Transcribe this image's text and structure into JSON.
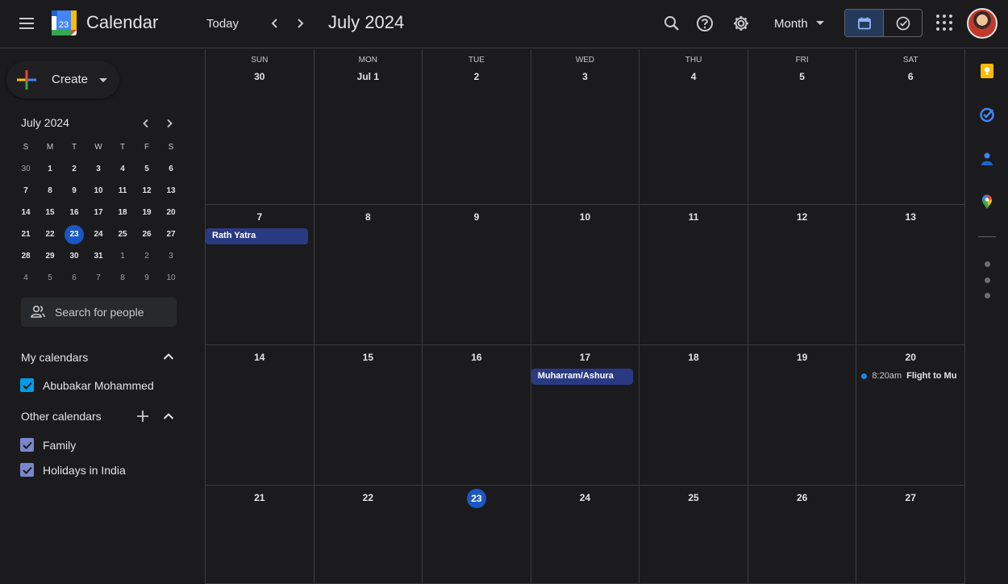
{
  "header": {
    "app_title": "Calendar",
    "logo_day": "23",
    "today_label": "Today",
    "current_range": "July 2024",
    "view_label": "Month"
  },
  "sidebar": {
    "create_label": "Create",
    "mini_calendar": {
      "title": "July 2024",
      "weekdays": [
        "S",
        "M",
        "T",
        "W",
        "T",
        "F",
        "S"
      ],
      "weeks": [
        [
          "30",
          "1",
          "2",
          "3",
          "4",
          "5",
          "6"
        ],
        [
          "7",
          "8",
          "9",
          "10",
          "11",
          "12",
          "13"
        ],
        [
          "14",
          "15",
          "16",
          "17",
          "18",
          "19",
          "20"
        ],
        [
          "21",
          "22",
          "23",
          "24",
          "25",
          "26",
          "27"
        ],
        [
          "28",
          "29",
          "30",
          "31",
          "1",
          "2",
          "3"
        ],
        [
          "4",
          "5",
          "6",
          "7",
          "8",
          "9",
          "10"
        ]
      ]
    },
    "search_people_placeholder": "Search for people",
    "my_calendars": {
      "title": "My calendars",
      "items": [
        {
          "label": "Abubakar Mohammed",
          "color": "#039be5",
          "checked": true
        }
      ]
    },
    "other_calendars": {
      "title": "Other calendars",
      "items": [
        {
          "label": "Family",
          "color": "#7986cb",
          "checked": true
        },
        {
          "label": "Holidays in India",
          "color": "#7986cb",
          "checked": true
        }
      ]
    }
  },
  "month_grid": {
    "weekdays": [
      "SUN",
      "MON",
      "TUE",
      "WED",
      "THU",
      "FRI",
      "SAT"
    ],
    "weeks": [
      [
        "30",
        "Jul 1",
        "2",
        "3",
        "4",
        "5",
        "6"
      ],
      [
        "7",
        "8",
        "9",
        "10",
        "11",
        "12",
        "13"
      ],
      [
        "14",
        "15",
        "16",
        "17",
        "18",
        "19",
        "20"
      ],
      [
        "21",
        "22",
        "23",
        "24",
        "25",
        "26",
        "27"
      ]
    ],
    "today": "23",
    "events": [
      {
        "title": "Rath Yatra",
        "week": 1,
        "day": 0,
        "type": "allday",
        "color": "#2a3a82"
      },
      {
        "title": "Muharram/Ashura",
        "week": 2,
        "day": 3,
        "type": "allday",
        "color": "#2a3a82"
      },
      {
        "time": "8:20am",
        "title": "Flight to Mu",
        "week": 2,
        "day": 6,
        "type": "timed",
        "color": "#1e88e5"
      }
    ]
  },
  "colors": {
    "background": "#1b1b1d",
    "accent": "#1a57c4",
    "event": "#2a3a82",
    "divider": "#3c3c3f"
  },
  "right_panel": {
    "icons": [
      "keep-icon",
      "tasks-icon",
      "contacts-icon",
      "maps-icon"
    ]
  }
}
